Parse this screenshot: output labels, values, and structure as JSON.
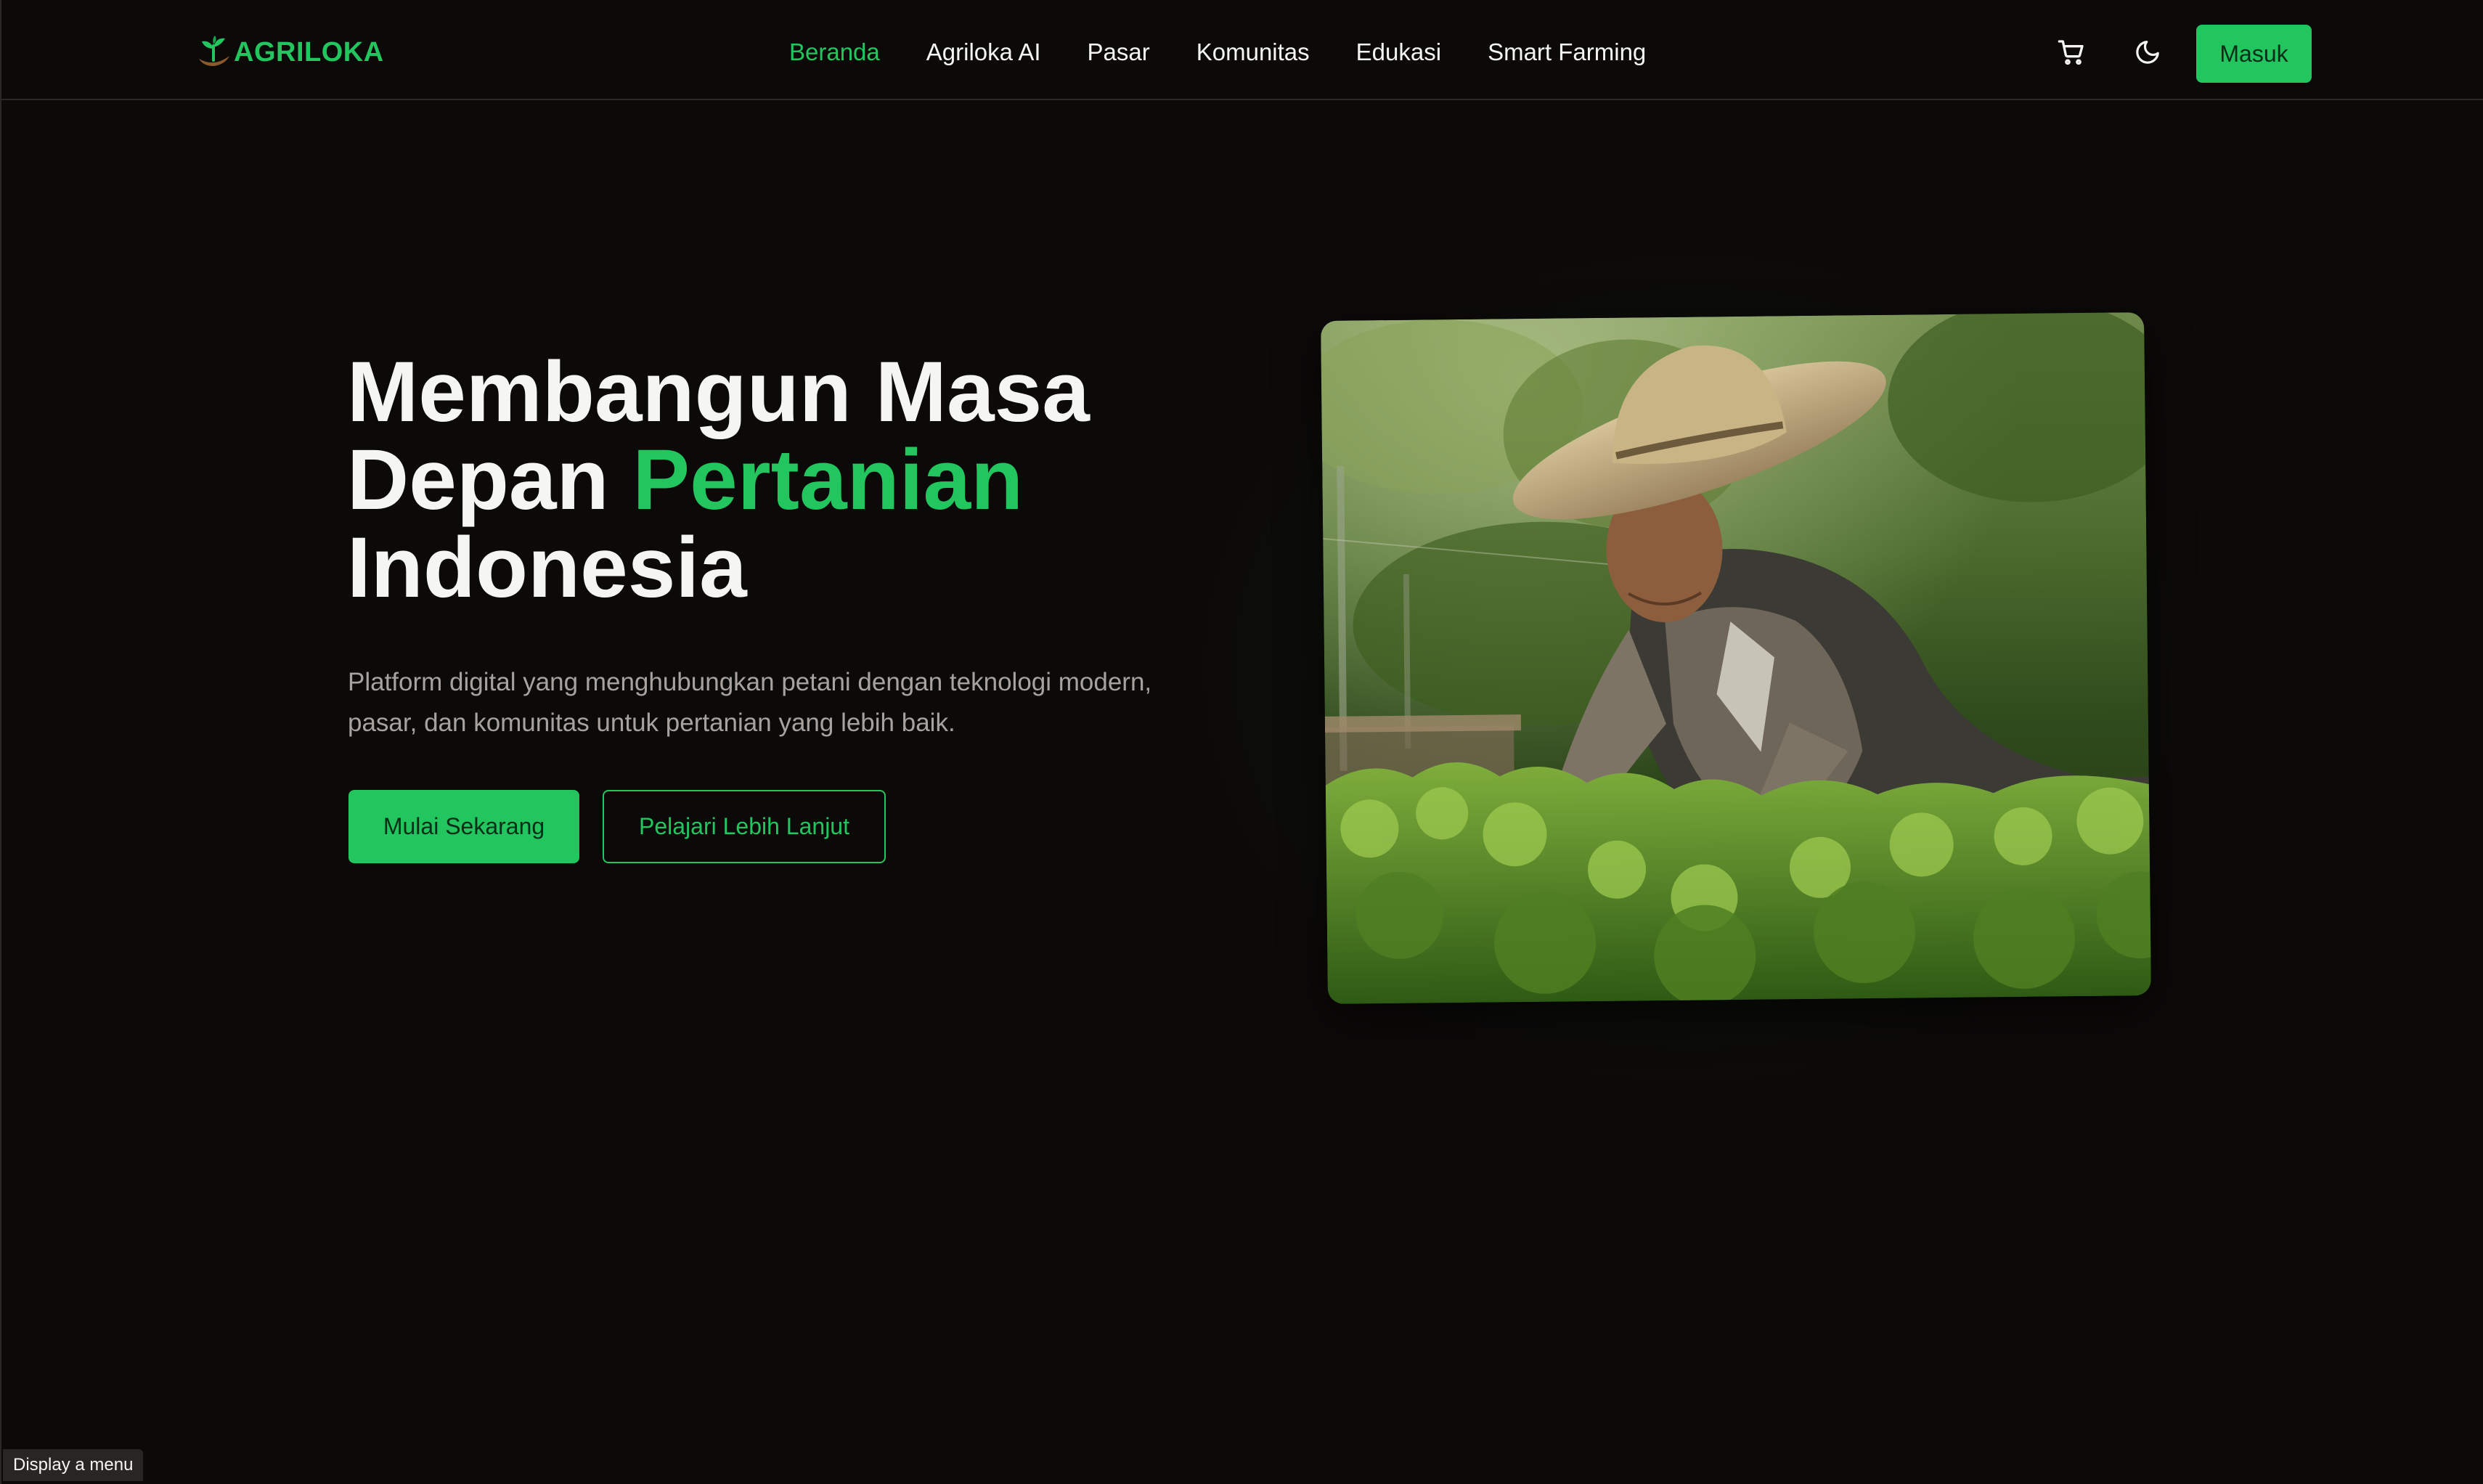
{
  "brand": {
    "name": "AGRILOKA",
    "accent_color": "#22c55e",
    "background_color": "#0c0a09"
  },
  "nav": {
    "items": [
      {
        "label": "Beranda",
        "active": true
      },
      {
        "label": "Agriloka AI",
        "active": false
      },
      {
        "label": "Pasar",
        "active": false
      },
      {
        "label": "Komunitas",
        "active": false
      },
      {
        "label": "Edukasi",
        "active": false
      },
      {
        "label": "Smart Farming",
        "active": false
      }
    ],
    "cart_icon": "shopping-cart-icon",
    "theme_icon": "moon-icon",
    "login_label": "Masuk"
  },
  "hero": {
    "title_line1": "Membangun Masa",
    "title_line2_prefix": "Depan ",
    "title_line2_accent": "Pertanian",
    "title_line3": "Indonesia",
    "subtitle": "Platform digital yang menghubungkan petani dengan teknologi modern, pasar, dan komunitas untuk pertanian yang lebih baik.",
    "primary_cta": "Mulai Sekarang",
    "secondary_cta": "Pelajari Lebih Lanjut",
    "image_subject": "elderly farmer in straw hat tending green crops"
  },
  "status_tooltip": "Display a menu"
}
